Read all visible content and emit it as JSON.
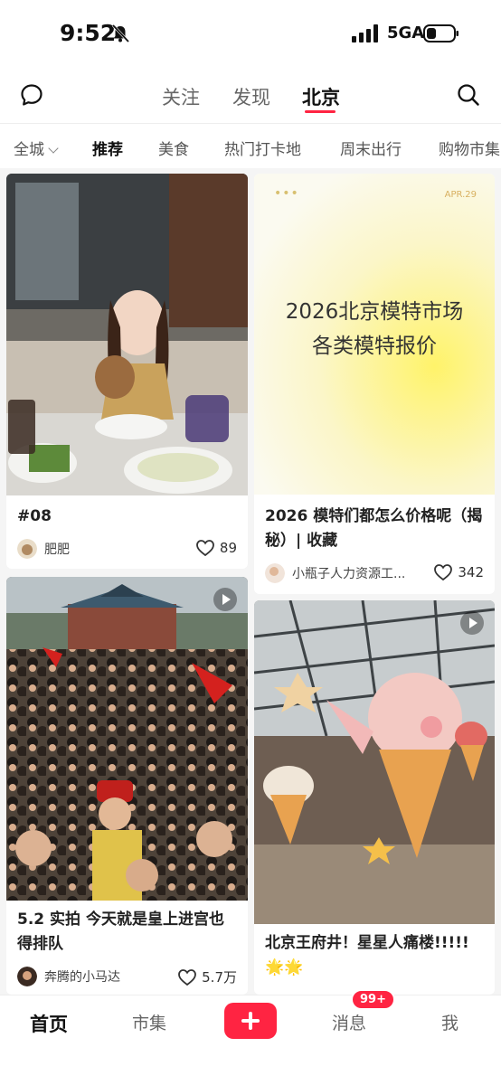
{
  "status": {
    "time": "9:52",
    "network": "5GA"
  },
  "top_nav": {
    "tabs": [
      "关注",
      "发现",
      "北京"
    ],
    "active_tab": "北京"
  },
  "filters": [
    "全城",
    "推荐",
    "美食",
    "热门打卡地",
    "周末出行",
    "购物市集"
  ],
  "cards": [
    {
      "title": "#08",
      "author": "肥肥",
      "likes": "89"
    },
    {
      "poster_line1": "2026北京模特市场",
      "poster_line2": "各类模特报价",
      "poster_date": "APR.29",
      "title": "2026 模特们都怎么价格呢（揭秘）| 收藏",
      "author": "小瓶子人力资源工...",
      "likes": "342"
    },
    {
      "title": "5.2 实拍 今天就是皇上进宫也得排队",
      "author": "奔腾的小马达",
      "likes": "5.7万"
    },
    {
      "title": "北京王府井！星星人痛楼!!!!! 🌟🌟",
      "author": "",
      "likes": ""
    }
  ],
  "bottom_nav": {
    "home": "首页",
    "market": "市集",
    "messages": "消息",
    "messages_badge": "99+",
    "me": "我"
  },
  "colors": {
    "accent": "#ff2442"
  }
}
